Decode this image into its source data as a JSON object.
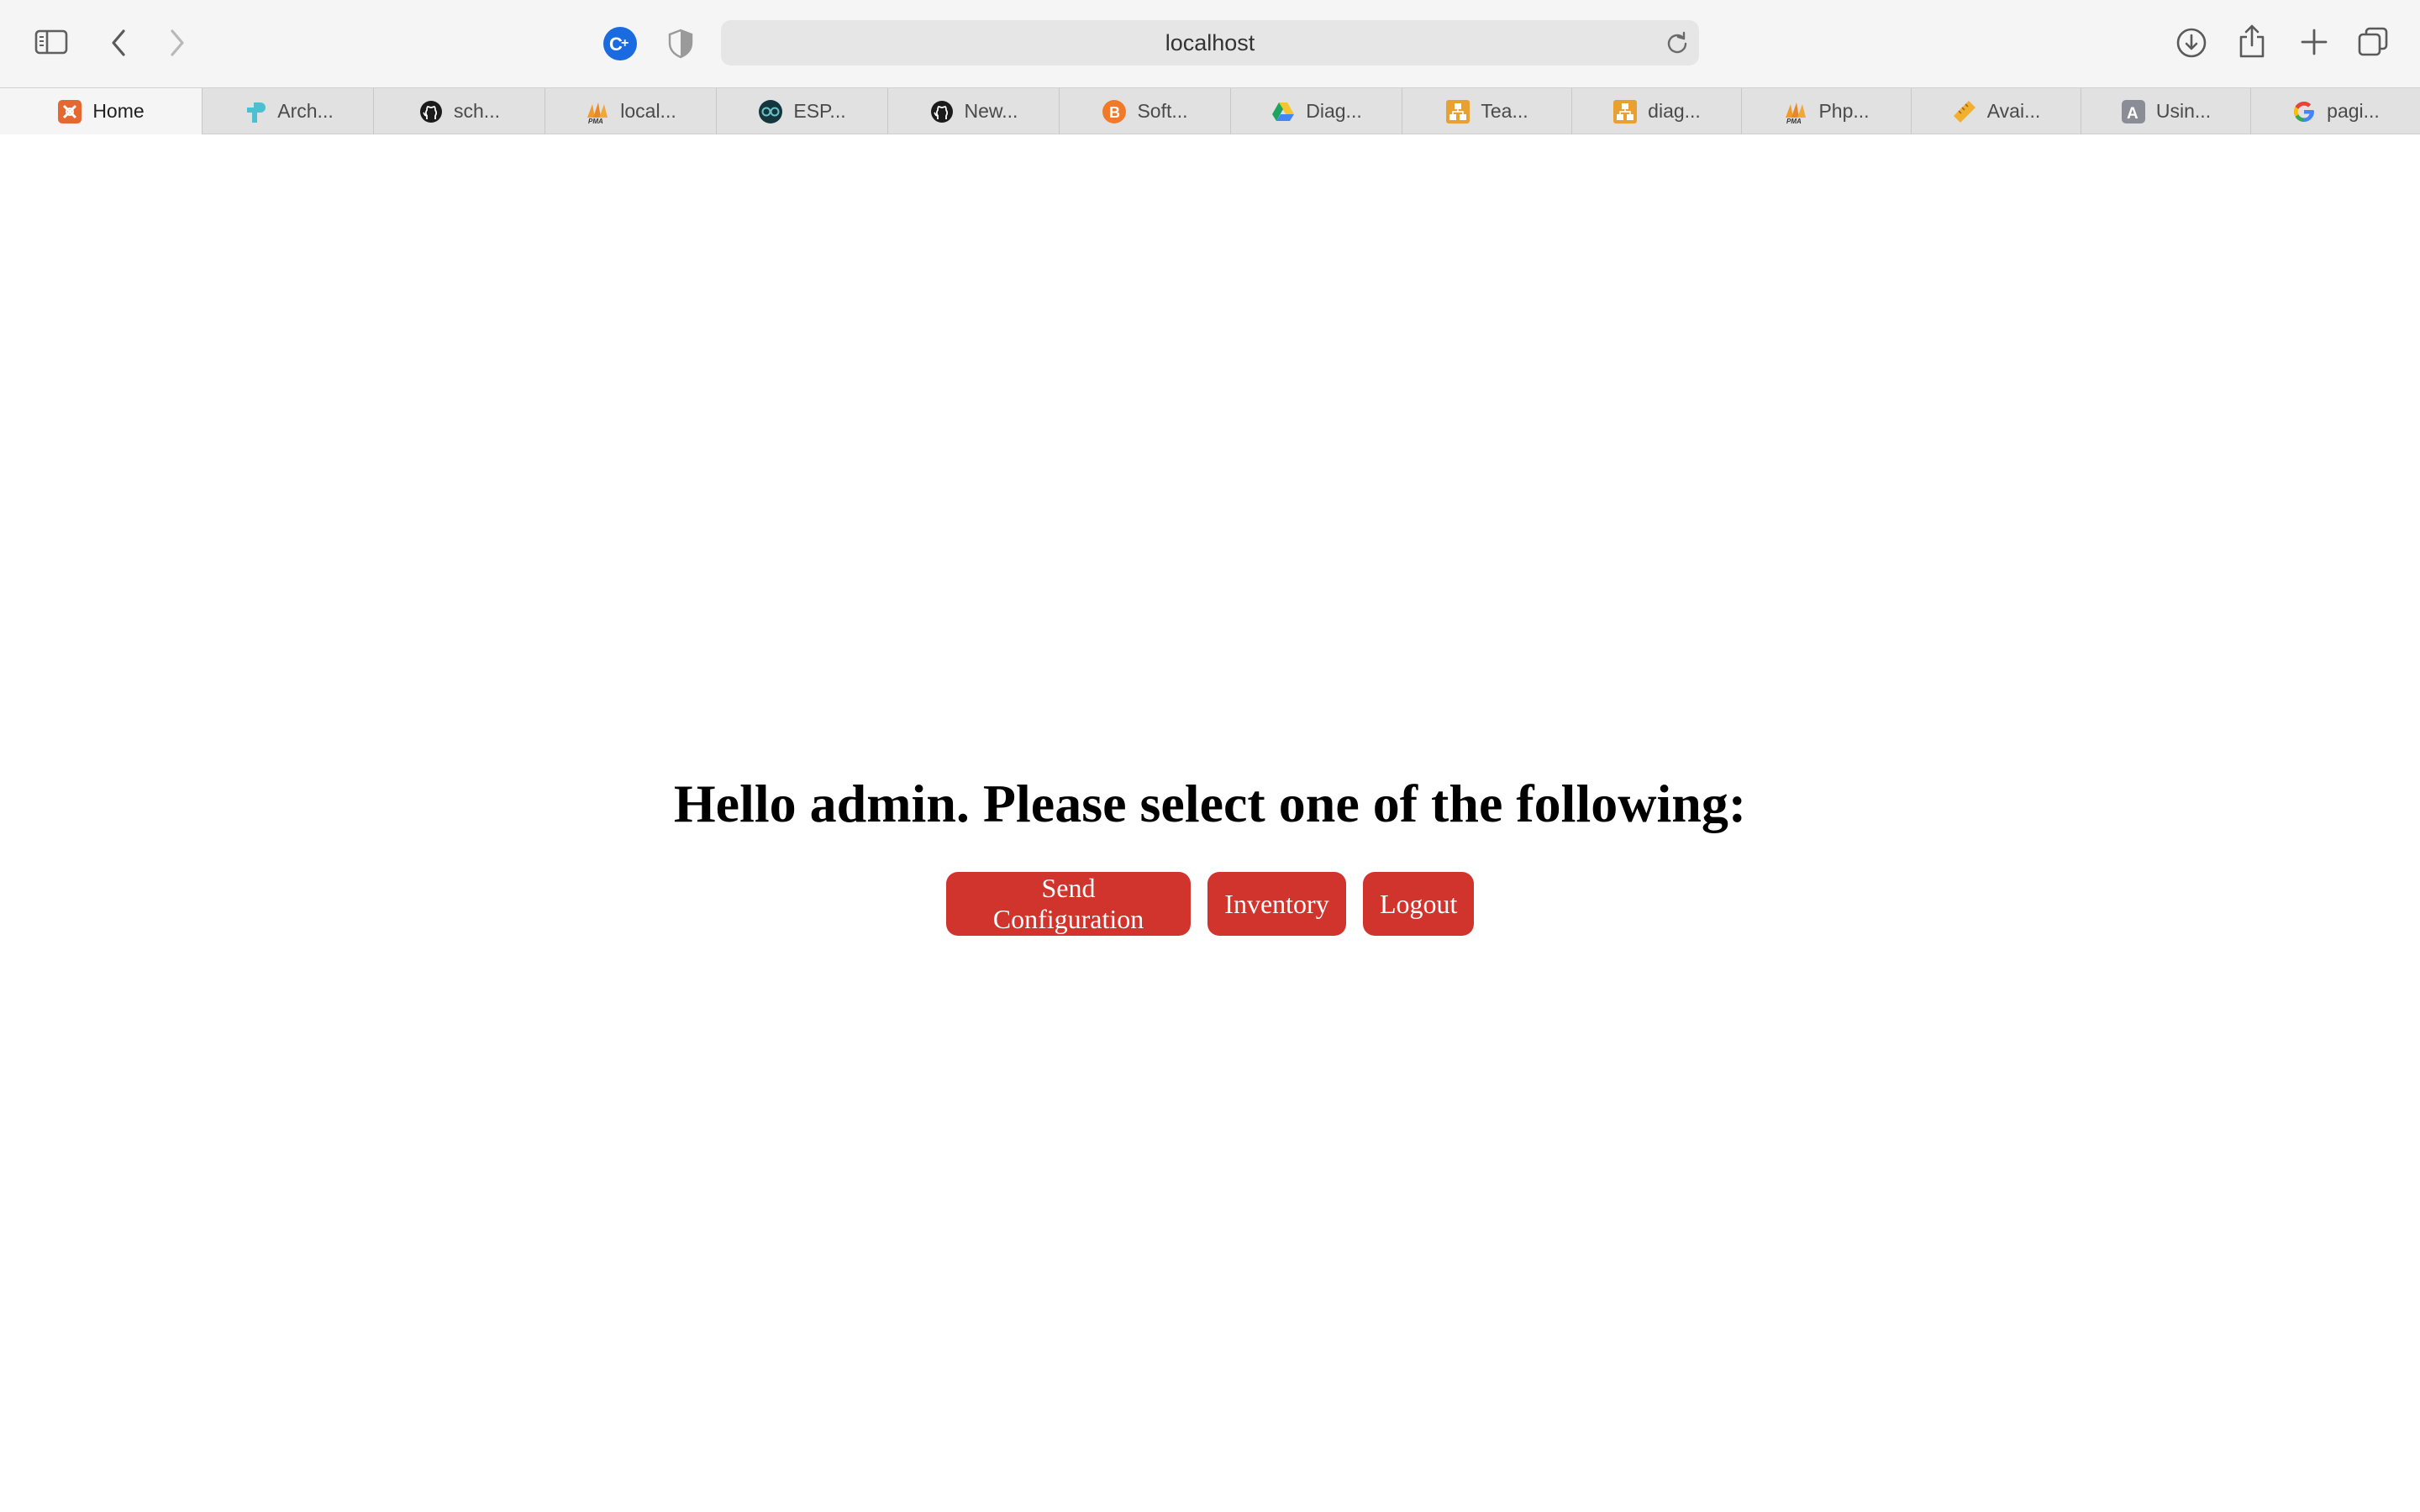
{
  "browser": {
    "url": "localhost",
    "icons": {
      "sidebar": "sidebar-icon",
      "back": "chevron-left-icon",
      "forward": "chevron-right-icon",
      "extension_1": "c-plus-extension-icon",
      "extension_2": "shield-icon",
      "reload": "reload-icon",
      "download": "download-icon",
      "share": "share-icon",
      "new_tab": "plus-icon",
      "tab_overview": "tabs-overview-icon"
    },
    "tabs": [
      {
        "label": "Home",
        "icon": "xampp-icon"
      },
      {
        "label": "Arch...",
        "icon": "tplink-icon"
      },
      {
        "label": "sch...",
        "icon": "github-icon"
      },
      {
        "label": "local...",
        "icon": "phpmyadmin-icon"
      },
      {
        "label": "ESP...",
        "icon": "arduino-icon"
      },
      {
        "label": "New...",
        "icon": "github-icon"
      },
      {
        "label": "Soft...",
        "icon": "bitcoin-icon"
      },
      {
        "label": "Diag...",
        "icon": "google-drive-icon"
      },
      {
        "label": "Tea...",
        "icon": "diagram-icon"
      },
      {
        "label": "diag...",
        "icon": "diagram-icon"
      },
      {
        "label": "Php...",
        "icon": "phpmyadmin-icon"
      },
      {
        "label": "Avai...",
        "icon": "ruler-icon"
      },
      {
        "label": "Usin...",
        "icon": "letter-a-icon"
      },
      {
        "label": "pagi...",
        "icon": "google-icon"
      }
    ]
  },
  "page": {
    "heading": "Hello admin. Please select one of the following:",
    "buttons": {
      "send_configuration": "Send Configuration",
      "inventory": "Inventory",
      "logout": "Logout"
    },
    "colors": {
      "button_bg": "#d1342c",
      "button_text": "#ffffff"
    }
  }
}
